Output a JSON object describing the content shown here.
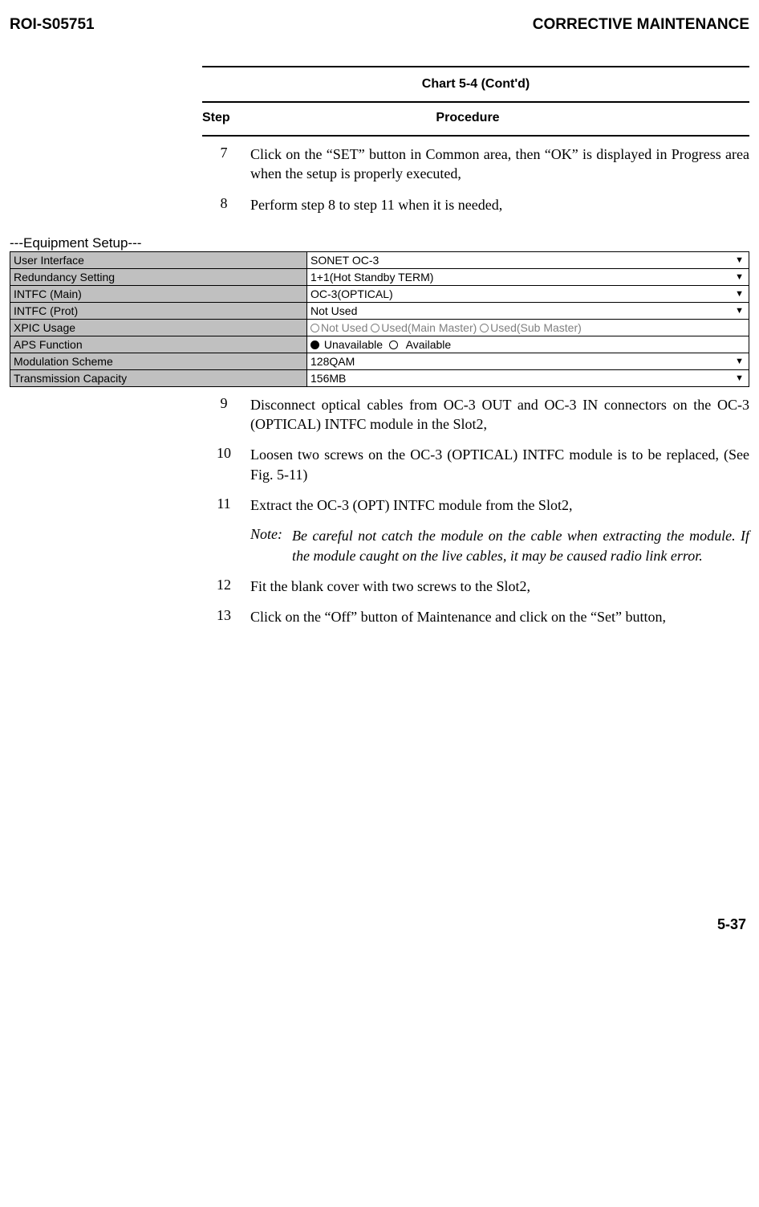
{
  "doc_id": "ROI-S05751",
  "section_title": "CORRECTIVE MAINTENANCE",
  "chart_caption": "Chart 5-4  (Cont'd)",
  "labels": {
    "step": "Step",
    "procedure": "Procedure"
  },
  "steps": {
    "s7": {
      "n": "7",
      "txt": "Click on the “SET” button in Common area, then “OK” is displayed in Progress area when the setup is properly executed,"
    },
    "s8": {
      "n": "8",
      "txt": "Perform step 8 to step 11 when it is needed,"
    },
    "s9": {
      "n": "9",
      "txt": "Disconnect optical cables from OC-3 OUT and OC-3 IN connectors on the OC-3 (OPTICAL) INTFC module in the Slot2,"
    },
    "s10": {
      "n": "10",
      "txt": "Loosen two screws on the OC-3 (OPTICAL) INTFC module is to be replaced, (See Fig. 5-11)"
    },
    "s11": {
      "n": "11",
      "txt": "Extract the OC-3 (OPT) INTFC module from the Slot2,"
    },
    "s12": {
      "n": "12",
      "txt": "Fit the blank cover with two screws to the Slot2,"
    },
    "s13": {
      "n": "13",
      "txt": "Click on the “Off” button of Maintenance and click on the “Set” button,"
    }
  },
  "note": {
    "label": "Note:",
    "txt": "Be careful not catch the module on the cable when extracting the module.  If the module caught on the live cables, it may be caused radio link error."
  },
  "setup_heading": "---Equipment Setup---",
  "setup": {
    "user_interface": {
      "label": "User Interface",
      "value": "SONET OC-3"
    },
    "redundancy": {
      "label": "Redundancy Setting",
      "value": "1+1(Hot Standby TERM)"
    },
    "intfc_main": {
      "label": "INTFC (Main)",
      "value": "OC-3(OPTICAL)"
    },
    "intfc_prot": {
      "label": "INTFC (Prot)",
      "value": "Not Used"
    },
    "xpic": {
      "label": "XPIC Usage",
      "opt1": "Not Used",
      "opt2": "Used(Main Master)",
      "opt3": "Used(Sub Master)"
    },
    "aps": {
      "label": "APS Function",
      "opt1": "Unavailable",
      "opt2": "Available"
    },
    "modulation": {
      "label": "Modulation Scheme",
      "value": "128QAM"
    },
    "capacity": {
      "label": "Transmission Capacity",
      "value": "156MB"
    }
  },
  "page_number": "5-37"
}
